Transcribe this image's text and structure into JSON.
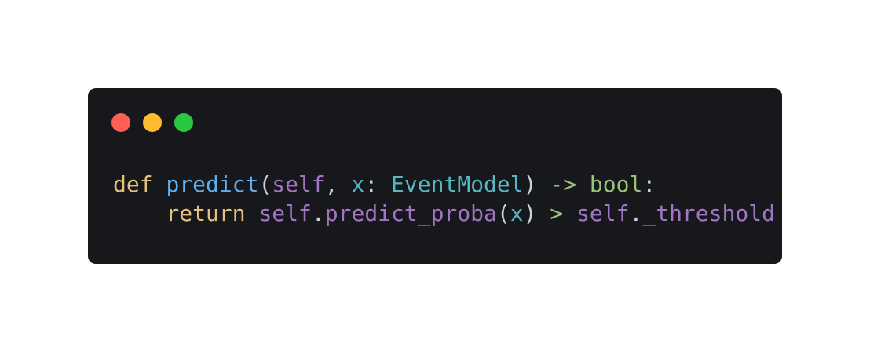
{
  "window": {
    "buttons": [
      {
        "name": "close",
        "color": "#ff5f57"
      },
      {
        "name": "minimize",
        "color": "#febc2e"
      },
      {
        "name": "maximize",
        "color": "#28c840"
      }
    ],
    "background": "#17181b"
  },
  "code": {
    "lines": [
      [
        {
          "text": "def",
          "type": "keyword"
        },
        {
          "text": " ",
          "type": "plain"
        },
        {
          "text": "predict",
          "type": "func"
        },
        {
          "text": "(",
          "type": "plain"
        },
        {
          "text": "self",
          "type": "purple"
        },
        {
          "text": ", ",
          "type": "plain"
        },
        {
          "text": "x",
          "type": "blue"
        },
        {
          "text": ": ",
          "type": "plain"
        },
        {
          "text": "EventModel",
          "type": "blue"
        },
        {
          "text": ") ",
          "type": "plain"
        },
        {
          "text": "->",
          "type": "green"
        },
        {
          "text": " ",
          "type": "plain"
        },
        {
          "text": "bool",
          "type": "green"
        },
        {
          "text": ":",
          "type": "plain"
        }
      ],
      [
        {
          "text": "    ",
          "type": "plain"
        },
        {
          "text": "return",
          "type": "keyword"
        },
        {
          "text": " ",
          "type": "plain"
        },
        {
          "text": "self",
          "type": "purple"
        },
        {
          "text": ".",
          "type": "plain"
        },
        {
          "text": "predict_proba",
          "type": "purple"
        },
        {
          "text": "(",
          "type": "plain"
        },
        {
          "text": "x",
          "type": "blue"
        },
        {
          "text": ") ",
          "type": "plain"
        },
        {
          "text": ">",
          "type": "green"
        },
        {
          "text": " ",
          "type": "plain"
        },
        {
          "text": "self",
          "type": "purple"
        },
        {
          "text": ".",
          "type": "plain"
        },
        {
          "text": "_threshold",
          "type": "purple"
        }
      ]
    ]
  }
}
